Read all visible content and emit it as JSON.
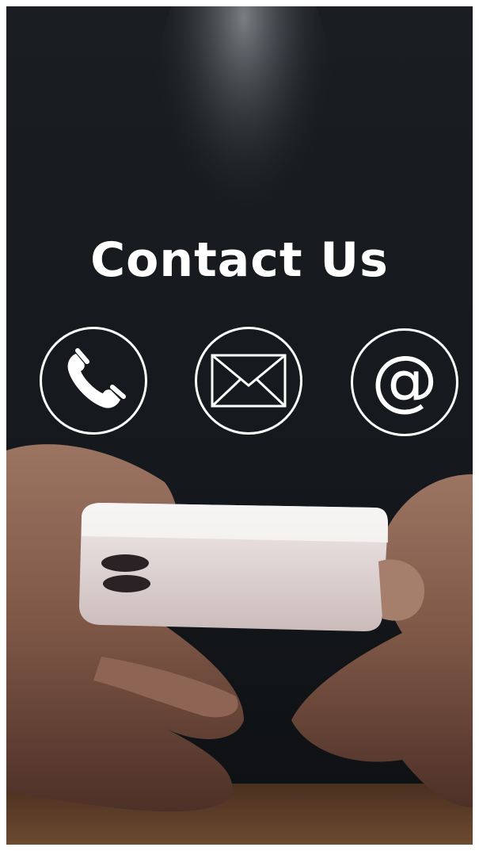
{
  "hero": {
    "title": "Contact Us"
  },
  "contact_options": [
    {
      "icon": "phone-icon"
    },
    {
      "icon": "envelope-icon"
    },
    {
      "icon": "at-sign-icon",
      "glyph": "@"
    }
  ],
  "colors": {
    "background": "#14181c",
    "foreground": "#ffffff"
  }
}
